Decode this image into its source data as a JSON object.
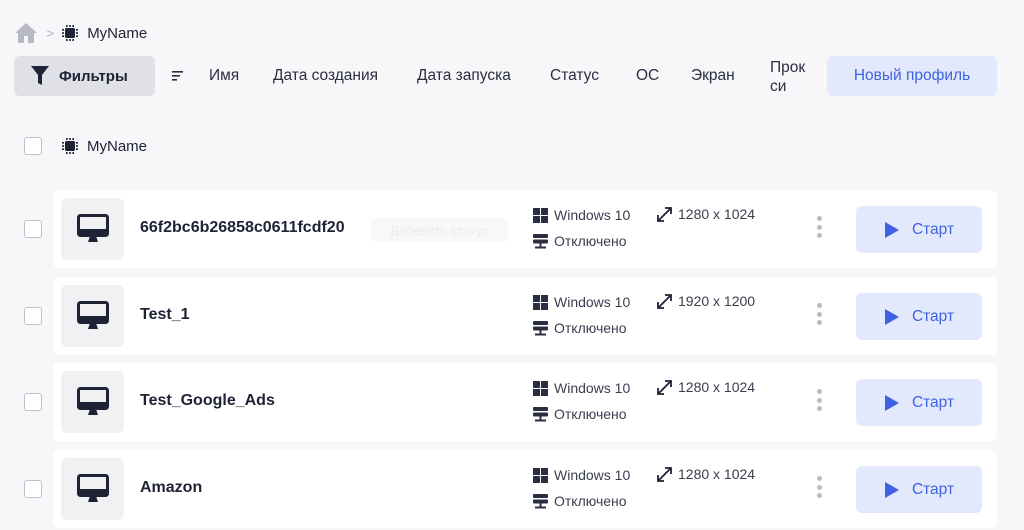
{
  "breadcrumb": {
    "home_icon": "home-icon",
    "separator": ">",
    "folder_icon": "chip-icon",
    "name": "MyName"
  },
  "toolbar": {
    "filters_label": "Фильтры",
    "columns": {
      "name": "Имя",
      "created": "Дата создания",
      "launched": "Дата запуска",
      "status": "Статус",
      "os": "ОС",
      "screen": "Экран",
      "proxy_line1": "Прок",
      "proxy_line2": "си"
    },
    "new_profile_label": "Новый профиль"
  },
  "group": {
    "name": "MyName"
  },
  "colors": {
    "accent": "#3f62e0",
    "accent_bg": "#e3e9fd",
    "background": "#f7f7f9"
  },
  "profiles": [
    {
      "name": "66f2bc6b26858c0611fcdf20",
      "status_tag": "Добавить статус",
      "os": "Windows 10",
      "proxy": "Отключено",
      "resolution": "1280 x 1024",
      "start_label": "Старт"
    },
    {
      "name": "Test_1",
      "os": "Windows 10",
      "proxy": "Отключено",
      "resolution": "1920 x 1200",
      "start_label": "Старт"
    },
    {
      "name": "Test_Google_Ads",
      "os": "Windows 10",
      "proxy": "Отключено",
      "resolution": "1280 x 1024",
      "start_label": "Старт"
    },
    {
      "name": "Amazon",
      "os": "Windows 10",
      "proxy": "Отключено",
      "resolution": "1280 x 1024",
      "start_label": "Старт"
    }
  ]
}
